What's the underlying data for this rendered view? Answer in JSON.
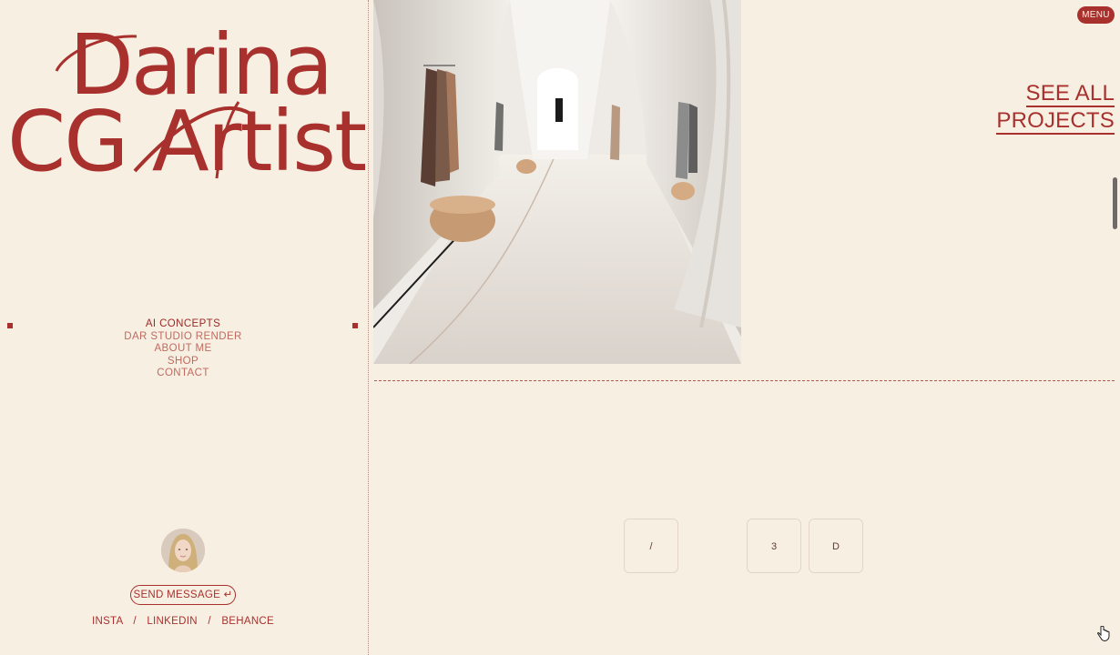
{
  "brand": {
    "line1": "Darina",
    "line2": "CG Artist"
  },
  "menu_button": {
    "label": "MENU"
  },
  "nav": {
    "items": [
      {
        "label": "AI CONCEPTS",
        "active": true
      },
      {
        "label": "DAR STUDIO RENDER",
        "active": false
      },
      {
        "label": "ABOUT ME",
        "active": false
      },
      {
        "label": "SHOP",
        "active": false
      },
      {
        "label": "CONTACT",
        "active": false
      }
    ]
  },
  "see_all": {
    "line1": "SEE ALL",
    "line2": "PROJECTS"
  },
  "contact": {
    "send_label": "SEND MESSAGE ↵",
    "socials": [
      "INSTA",
      "LINKEDIN",
      "BEHANCE"
    ],
    "separator": "/"
  },
  "keys": [
    "/",
    "3",
    "D"
  ],
  "colors": {
    "background": "#f8efe3",
    "accent": "#a8302d",
    "muted_link": "#c06a5f"
  },
  "icons": {
    "cursor": "hand-pointer-icon",
    "nav_marker": "square-marker-icon"
  }
}
